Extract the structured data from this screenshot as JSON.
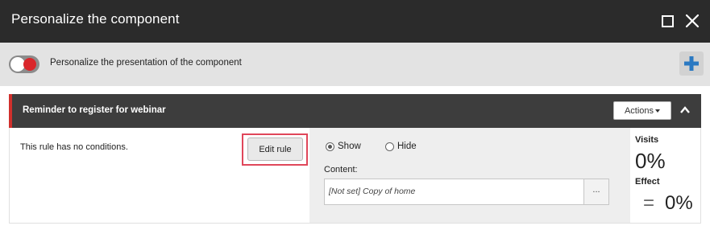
{
  "dialog": {
    "title": "Personalize the component"
  },
  "personalize": {
    "toggle_label": "Personalize the presentation of the component",
    "toggle_on": true,
    "accent_color": "#d9262b",
    "add_icon_color": "#2b79c2"
  },
  "rule": {
    "title": "Reminder to register for webinar",
    "actions_label": "Actions",
    "conditions_text": "This rule has no conditions.",
    "edit_rule_label": "Edit rule",
    "show_label": "Show",
    "hide_label": "Hide",
    "selected_action": "Show",
    "content_label": "Content:",
    "content_value": "[Not set] Copy of home",
    "browse_label": "...",
    "visits_label": "Visits",
    "visits_value": "0%",
    "effect_label": "Effect",
    "effect_symbol": "=",
    "effect_value": "0%"
  }
}
